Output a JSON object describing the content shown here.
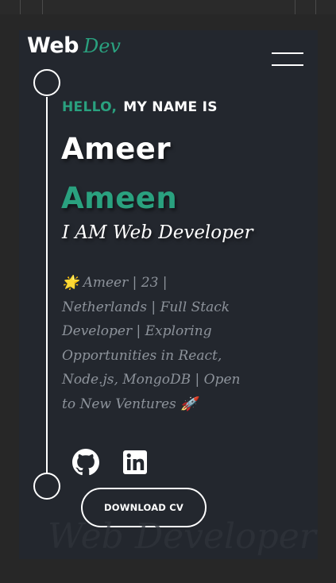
{
  "logo": {
    "main": "Web",
    "accent": "Dev"
  },
  "hero": {
    "greeting_accent": "HELLO,",
    "greeting_rest": "MY NAME IS",
    "first_name": "Ameer",
    "last_name": "Ameen",
    "role": "I AM Web Developer",
    "bio": "🌟 Ameer | 23 | Netherlands | Full Stack Developer | Exploring Opportunities in React, Node.js, MongoDB | Open to New Ventures 🚀"
  },
  "social": [
    {
      "icon": "github-icon"
    },
    {
      "icon": "linkedin-icon"
    }
  ],
  "cta": {
    "label": "DOWNLOAD CV"
  },
  "watermark": "Web Developer",
  "colors": {
    "accent": "#2aa17f",
    "card": "#23272e",
    "page": "#272727",
    "muted_text": "#8d939b"
  }
}
